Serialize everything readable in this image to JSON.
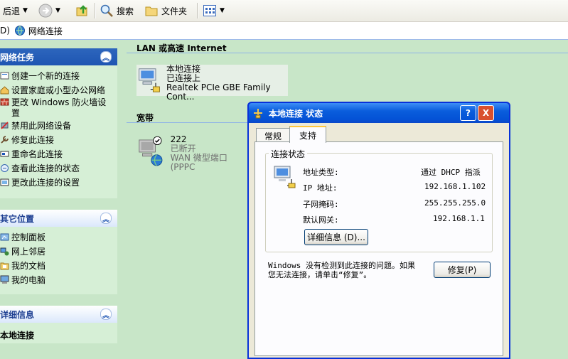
{
  "toolbar": {
    "back_label": "后退",
    "search_label": "搜索",
    "folders_label": "文件夹"
  },
  "address": {
    "prefix": "D)",
    "path": "网络连接"
  },
  "panes": {
    "network_tasks": {
      "title": "网络任务",
      "items": [
        "创建一个新的连接",
        "设置家庭或小型办公网络",
        "更改 Windows 防火墙设",
        "置",
        "禁用此网络设备",
        "修复此连接",
        "重命名此连接",
        "查看此连接的状态",
        "更改此连接的设置"
      ]
    },
    "other_places": {
      "title": "其它位置",
      "items": [
        "控制面板",
        "网上邻居",
        "我的文档",
        "我的电脑"
      ]
    },
    "details": {
      "title": "详细信息",
      "item": "本地连接"
    }
  },
  "main": {
    "lan_section": "LAN 或高速 Internet",
    "broadband_section": "宽带",
    "lan_conn": {
      "name": "本地连接",
      "status": "已连接上",
      "device": "Realtek PCIe GBE Family Cont..."
    },
    "bb_conn": {
      "name": "222",
      "status": "已断开",
      "device": "WAN 微型端口 (PPPC"
    }
  },
  "dialog": {
    "title": "本地连接 状态",
    "help_btn": "?",
    "close_btn": "X",
    "tabs": [
      "常规",
      "支持"
    ],
    "group_title": "连接状态",
    "rows": [
      {
        "label": "地址类型:",
        "value": "通过 DHCP 指派"
      },
      {
        "label": "IP 地址:",
        "value": "192.168.1.102"
      },
      {
        "label": "子网掩码:",
        "value": "255.255.255.0"
      },
      {
        "label": "默认网关:",
        "value": "192.168.1.1"
      }
    ],
    "details_btn": "详细信息 (D)...",
    "message_line1": "Windows 没有检测到此连接的问题。如果",
    "message_line2": "您无法连接，请单击“修复”。",
    "repair_btn": "修复(P)"
  },
  "colors": {
    "background": "#c8e6c8",
    "title_bar": "#0a5ddc",
    "pane_header": "#1e55b2"
  }
}
